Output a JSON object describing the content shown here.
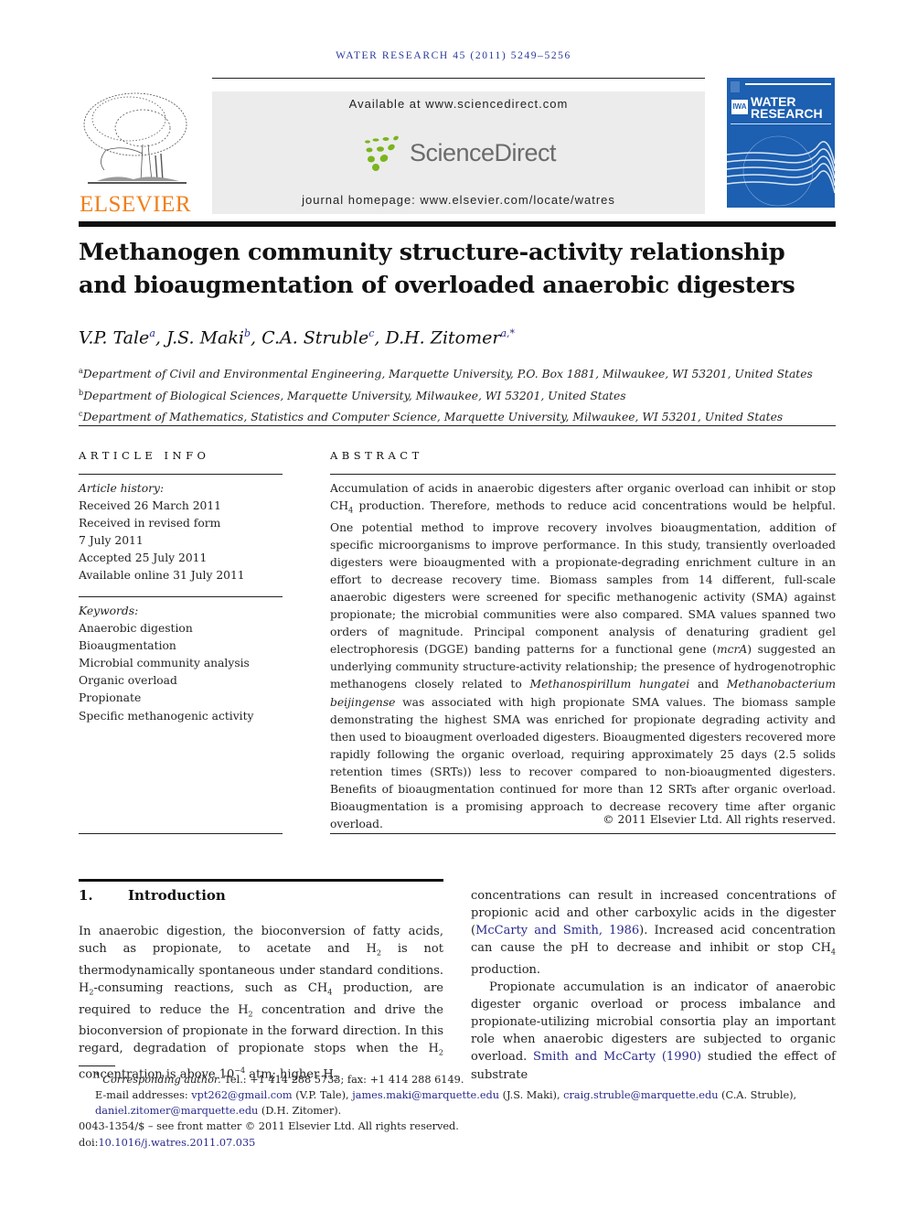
{
  "running_head": "WATER RESEARCH 45 (2011) 5249–5256",
  "publisher": {
    "logo_word": "ELSEVIER",
    "logo_color": "#f07f1a",
    "logo_icon": "elsevier-tree-icon"
  },
  "sciencedirect": {
    "available": "Available at www.sciencedirect.com",
    "brand": "ScienceDirect",
    "brand_icon": "sciencedirect-dots-icon",
    "brand_dot_color": "#7ab51d",
    "homepage": "journal homepage: www.elsevier.com/locate/watres"
  },
  "journal_cover": {
    "badge": "IWA",
    "title_line1": "WATER",
    "title_line2": "RESEARCH",
    "color": "#1d5fb0"
  },
  "article": {
    "title": "Methanogen community structure-activity relationship and bioaugmentation of overloaded anaerobic digesters",
    "authors": [
      {
        "name": "V.P. Tale",
        "sup": "a"
      },
      {
        "name": "J.S. Maki",
        "sup": "b"
      },
      {
        "name": "C.A. Struble",
        "sup": "c"
      },
      {
        "name": "D.H. Zitomer",
        "sup": "a,*"
      }
    ],
    "affiliations": [
      {
        "sup": "a",
        "text": "Department of Civil and Environmental Engineering, Marquette University, P.O. Box 1881, Milwaukee, WI 53201, United States"
      },
      {
        "sup": "b",
        "text": "Department of Biological Sciences, Marquette University, Milwaukee, WI 53201, United States"
      },
      {
        "sup": "c",
        "text": "Department of Mathematics, Statistics and Computer Science, Marquette University, Milwaukee, WI 53201, United States"
      }
    ]
  },
  "article_info": {
    "heading": "ARTICLE INFO",
    "history_label": "Article history:",
    "history": [
      "Received 26 March 2011",
      "Received in revised form",
      "7 July 2011",
      "Accepted 25 July 2011",
      "Available online 31 July 2011"
    ],
    "keywords_label": "Keywords:",
    "keywords": [
      "Anaerobic digestion",
      "Bioaugmentation",
      "Microbial community analysis",
      "Organic overload",
      "Propionate",
      "Specific methanogenic activity"
    ]
  },
  "abstract": {
    "heading": "ABSTRACT",
    "parts": {
      "p1": "Accumulation of acids in anaerobic digesters after organic overload can inhibit or stop CH",
      "p1_sub": "4",
      "p2": " production. Therefore, methods to reduce acid concentrations would be helpful. One potential method to improve recovery involves bioaugmentation, addition of specific microorganisms to improve performance. In this study, transiently overloaded digesters were bioaugmented with a propionate-degrading enrichment culture in an effort to decrease recovery time. Biomass samples from 14 different, full-scale anaerobic digesters were screened for specific methanogenic activity (SMA) against propionate; the microbial communities were also compared. SMA values spanned two orders of magnitude. Principal component analysis of denaturing gradient gel electrophoresis (DGGE) banding patterns for a functional gene (",
      "gene": "mcrA",
      "p3": ") suggested an underlying community structure-activity relationship; the presence of hydrogenotrophic methanogens closely related to ",
      "species1": "Methanospirillum hungatei",
      "p4": " and ",
      "species2": "Methanobacterium beijingense",
      "p5": " was associated with high propionate SMA values. The biomass sample demonstrating the highest SMA was enriched for propionate degrading activity and then used to bioaugment overloaded digesters. Bioaugmented digesters recovered more rapidly following the organic overload, requiring approximately 25 days (2.5 solids retention times (SRTs)) less to recover compared to non-bioaugmented digesters. Benefits of bioaugmentation continued for more than 12 SRTs after organic overload. Bioaugmentation is a promising approach to decrease recovery time after organic overload."
    },
    "copyright": "© 2011 Elsevier Ltd. All rights reserved."
  },
  "introduction": {
    "number": "1.",
    "heading": "Introduction",
    "col1": {
      "a": "In anaerobic digestion, the bioconversion of fatty acids, such as propionate, to acetate and H",
      "b": " is not thermodynamically spontaneous under standard conditions. H",
      "c": "-consuming reactions, such as CH",
      "d": " production, are required to reduce the H",
      "e": " concentration and drive the bioconversion of propionate in the forward direction. In this regard, degradation of propionate stops when the H",
      "f": " concentration is above 10",
      "exp": "−4",
      "g": " atm; higher H",
      "sub2": "2",
      "sub4": "4"
    },
    "col2": {
      "a": "concentrations can result in increased concentrations of propionic acid and other carboxylic acids in the digester (",
      "cite1": "McCarty and Smith, 1986",
      "b": "). Increased acid concentration can cause the pH to decrease and inhibit or stop CH",
      "c": " production.",
      "p2a": "Propionate accumulation is an indicator of anaerobic digester organic overload or process imbalance and propionate-utilizing microbial consortia play an important role when anaerobic digesters are subjected to organic overload. ",
      "cite2": "Smith and McCarty (1990)",
      "p2b": " studied the effect of substrate",
      "sub4": "4"
    }
  },
  "footnotes": {
    "star": "*",
    "corresponding_label": "Corresponding author.",
    "contact": " Tel.: +1 414 288 5733; fax: +1 414 288 6149.",
    "email_label": "E-mail addresses: ",
    "emails": [
      {
        "email": "vpt262@gmail.com",
        "who": " (V.P. Tale), "
      },
      {
        "email": "james.maki@marquette.edu",
        "who": " (J.S. Maki), "
      },
      {
        "email": "craig.struble@marquette.edu",
        "who": " (C.A. Struble), "
      },
      {
        "email": "daniel.zitomer@marquette.edu",
        "who": " (D.H. Zitomer)."
      }
    ],
    "issn_line": "0043-1354/$ – see front matter © 2011 Elsevier Ltd. All rights reserved.",
    "doi_label": "doi:",
    "doi": "10.1016/j.watres.2011.07.035"
  }
}
